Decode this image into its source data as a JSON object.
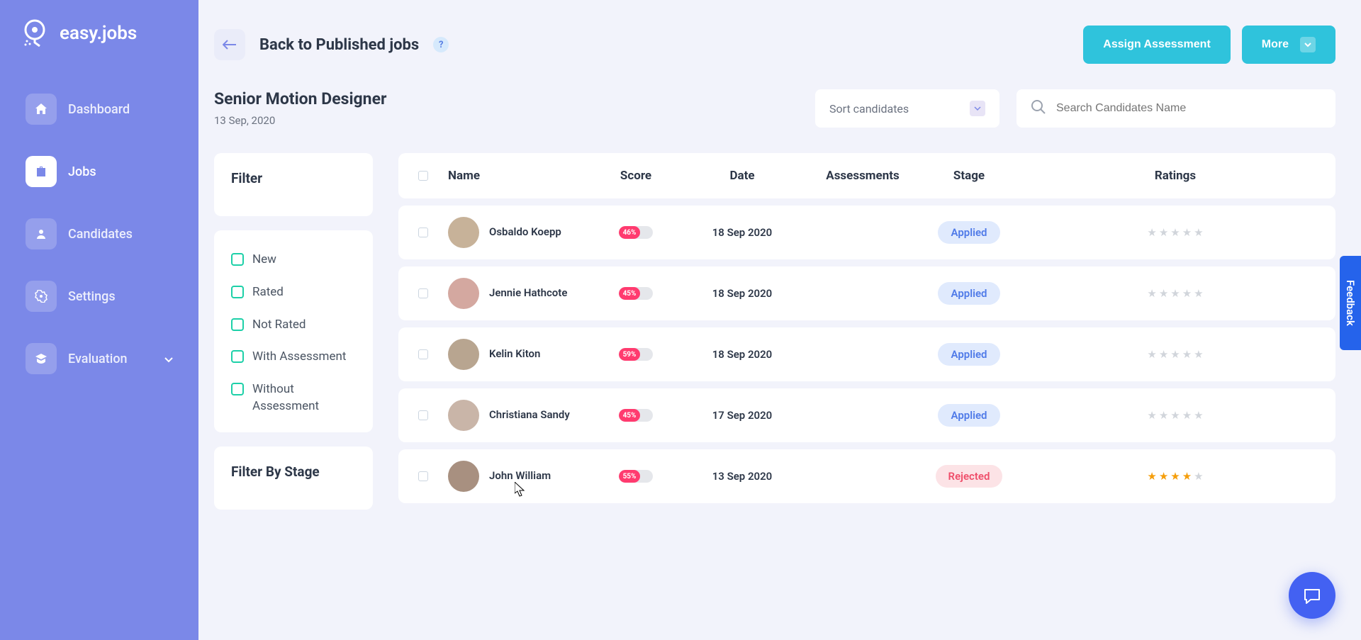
{
  "brand": {
    "name": "easy.jobs"
  },
  "sidebar": {
    "items": [
      {
        "label": "Dashboard",
        "icon": "home"
      },
      {
        "label": "Jobs",
        "icon": "briefcase",
        "active": true
      },
      {
        "label": "Candidates",
        "icon": "user"
      },
      {
        "label": "Settings",
        "icon": "gear"
      },
      {
        "label": "Evaluation",
        "icon": "graduation",
        "expandable": true
      }
    ]
  },
  "header": {
    "back_title": "Back to Published jobs",
    "assign_button": "Assign Assessment",
    "more_button": "More"
  },
  "job": {
    "title": "Senior Motion Designer",
    "date": "13 Sep, 2020"
  },
  "controls": {
    "sort_label": "Sort candidates",
    "search_placeholder": "Search Candidates Name"
  },
  "filter": {
    "title": "Filter",
    "options": [
      "New",
      "Rated",
      "Not Rated",
      "With Assessment",
      "Without Assessment"
    ],
    "stage_title": "Filter By Stage"
  },
  "table": {
    "columns": [
      "Name",
      "Score",
      "Date",
      "Assessments",
      "Stage",
      "Ratings"
    ],
    "rows": [
      {
        "name": "Osbaldo Koepp",
        "score": "46%",
        "score_width": 46,
        "date": "18 Sep 2020",
        "stage": "Applied",
        "stage_class": "applied",
        "rating": 0
      },
      {
        "name": "Jennie Hathcote",
        "score": "45%",
        "score_width": 45,
        "date": "18 Sep 2020",
        "stage": "Applied",
        "stage_class": "applied",
        "rating": 0
      },
      {
        "name": "Kelin Kiton",
        "score": "59%",
        "score_width": 59,
        "date": "18 Sep 2020",
        "stage": "Applied",
        "stage_class": "applied",
        "rating": 0
      },
      {
        "name": "Christiana Sandy",
        "score": "45%",
        "score_width": 45,
        "date": "17 Sep 2020",
        "stage": "Applied",
        "stage_class": "applied",
        "rating": 0
      },
      {
        "name": "John William",
        "score": "55%",
        "score_width": 55,
        "date": "13 Sep 2020",
        "stage": "Rejected",
        "stage_class": "rejected",
        "rating": 4
      }
    ]
  },
  "feedback_label": "Feedback"
}
